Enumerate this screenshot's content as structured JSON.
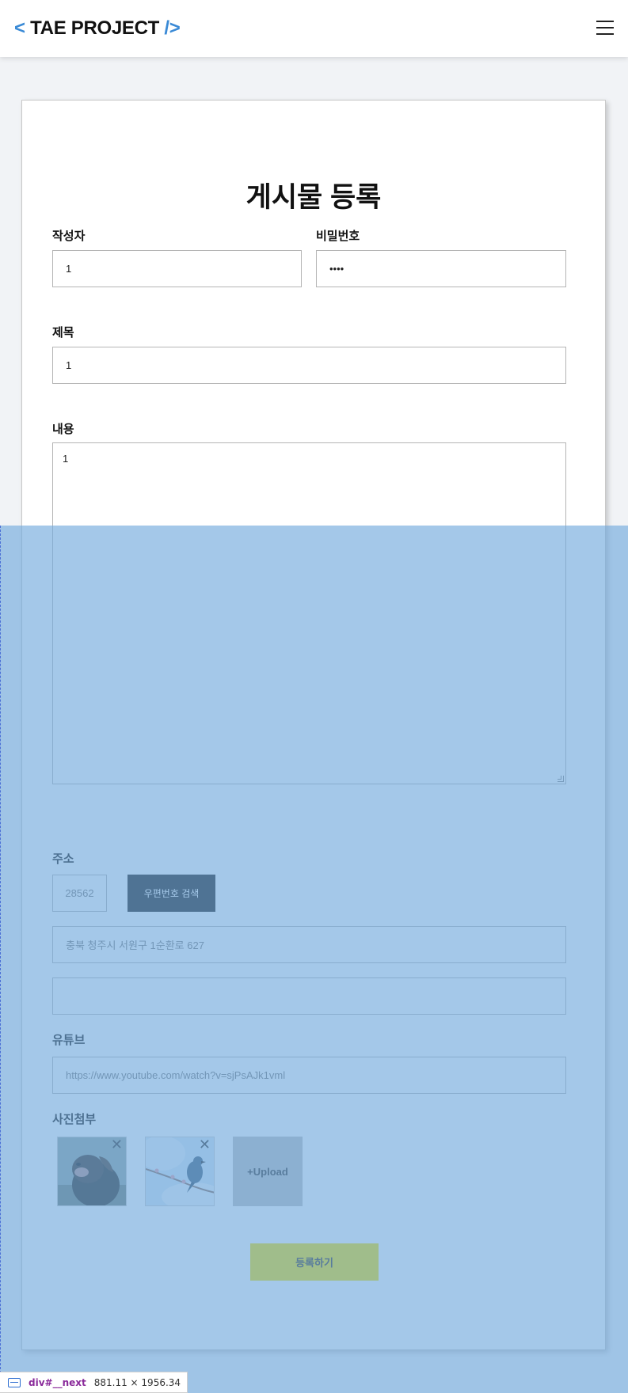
{
  "header": {
    "logo_open": "<",
    "logo_name": "TAE PROJECT",
    "logo_close": "/>",
    "menu_icon": "hamburger-icon"
  },
  "form": {
    "title": "게시물 등록",
    "writer_label": "작성자",
    "writer_value": "1",
    "password_label": "비밀번호",
    "password_value": "••••",
    "subject_label": "제목",
    "subject_value": "1",
    "contents_label": "내용",
    "contents_value": "1",
    "address_label": "주소",
    "zipcode_value": "28562",
    "zipcode_button": "우편번호 검색",
    "address_value": "충북 청주시 서원구 1순환로 627",
    "address_detail_value": "",
    "youtube_label": "유튜브",
    "youtube_value": "https://www.youtube.com/watch?v=sjPsAJk1vml",
    "photo_label": "사진첨부",
    "photo_close": "✕",
    "upload_label": "+Upload",
    "submit_label": "등록하기"
  },
  "devtools": {
    "selector": "div#__next",
    "dimensions": "881.11 × 1956.34"
  },
  "colors": {
    "accent": "#3a8ad6",
    "submit": "#f5e000",
    "overlay": "#6fa8dc"
  }
}
